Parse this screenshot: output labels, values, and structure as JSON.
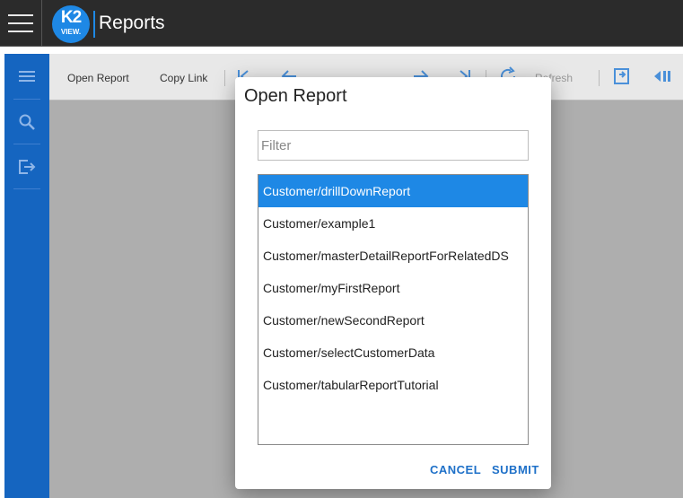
{
  "app": {
    "logo_text": "K2",
    "logo_subtext": "VIEW.",
    "title": "Reports"
  },
  "toolbar": {
    "open_report_label": "Open Report",
    "copy_link_label": "Copy Link",
    "refresh_label": "Refresh"
  },
  "dialog": {
    "title": "Open Report",
    "filter": {
      "placeholder": "Filter",
      "value": ""
    },
    "reports": [
      "Customer/drillDownReport",
      "Customer/example1",
      "Customer/masterDetailReportForRelatedDS",
      "Customer/myFirstReport",
      "Customer/newSecondReport",
      "Customer/selectCustomerData",
      "Customer/tabularReportTutorial"
    ],
    "selected_index": 0,
    "cancel_label": "CANCEL",
    "submit_label": "SUBMIT"
  },
  "icons": {
    "sidenav": [
      "menu-icon",
      "search-icon",
      "exit-icon"
    ],
    "toolbar": [
      "first-page-icon",
      "previous-page-icon",
      "next-page-icon",
      "last-page-icon",
      "refresh-icon",
      "export-icon",
      "collapse-panel-icon"
    ]
  },
  "colors": {
    "topbar": "#2b2b2b",
    "sidenav": "#1565c0",
    "accent": "#1e88e5",
    "button_text": "#1e70c8"
  }
}
